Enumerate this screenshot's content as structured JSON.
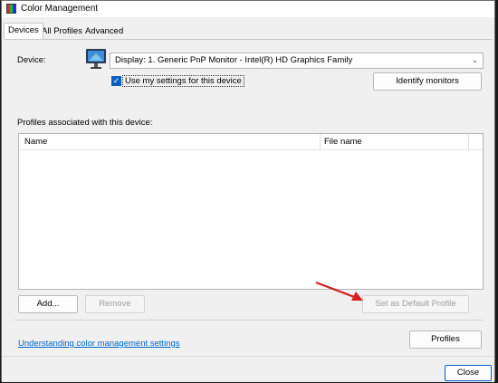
{
  "window": {
    "title": "Color Management"
  },
  "tabs": [
    {
      "label": "Devices",
      "active": true
    },
    {
      "label": "All Profiles",
      "active": false
    },
    {
      "label": "Advanced",
      "active": false
    }
  ],
  "device": {
    "label": "Device:",
    "selected": "Display: 1. Generic PnP Monitor - Intel(R) HD Graphics Family",
    "checkbox_label": "Use my settings for this device",
    "checkbox_checked": true,
    "identify_button": "Identify monitors"
  },
  "profiles": {
    "section_label": "Profiles associated with this device:",
    "columns": [
      "Name",
      "File name"
    ],
    "rows": [],
    "add_button": "Add...",
    "remove_button": "Remove",
    "set_default_button": "Set as Default Profile",
    "profiles_button": "Profiles"
  },
  "help_link": "Understanding color management settings",
  "close_button": "Close",
  "colors": {
    "accent": "#0a5fc4",
    "link": "#0066cc",
    "annotation_arrow": "#d61f1f"
  }
}
